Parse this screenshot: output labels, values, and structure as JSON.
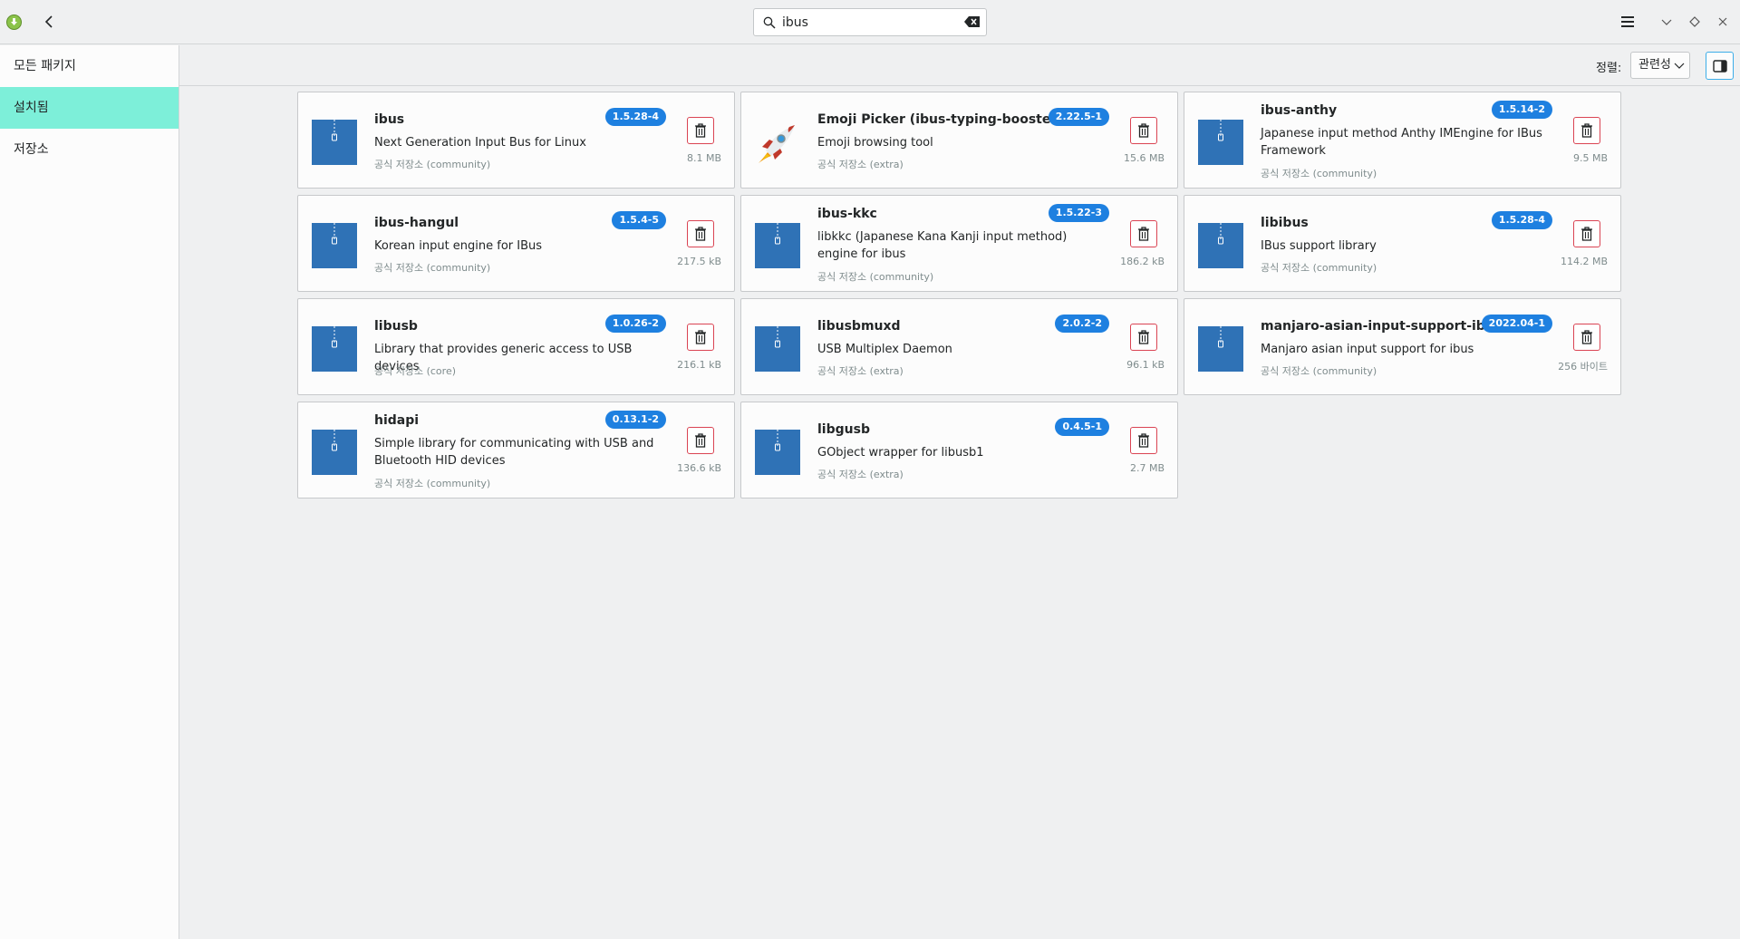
{
  "window": {
    "search_value": "ibus",
    "search_placeholder": "",
    "icons": {
      "logo": "pamac-logo-icon",
      "back": "chevron-left-icon",
      "search": "search-icon",
      "clear": "clear-text-icon",
      "menu": "hamburger-menu-icon",
      "minimize": "chevron-down-icon",
      "maximize": "diamond-icon",
      "close": "close-icon"
    }
  },
  "sidebar": {
    "items": [
      {
        "label": "모든 패키지",
        "active": false
      },
      {
        "label": "설치됨",
        "active": true
      },
      {
        "label": "저장소",
        "active": false
      }
    ]
  },
  "sortbar": {
    "label": "정렬:",
    "selected": "관련성"
  },
  "colors": {
    "accent": "#3daee9",
    "active_item": "#7defd9",
    "badge": "#1e80e0",
    "remove": "#da4453"
  },
  "packages": [
    {
      "name": "ibus",
      "version": "1.5.28-4",
      "desc": "Next Generation Input Bus for Linux",
      "repo": "공식 저장소 (community)",
      "size": "8.1 MB",
      "icon": "archive-icon"
    },
    {
      "name": "Emoji Picker (ibus-typing-booster)",
      "version": "2.22.5-1",
      "desc": "Emoji browsing tool",
      "repo": "공식 저장소 (extra)",
      "size": "15.6 MB",
      "icon": "rocket-icon"
    },
    {
      "name": "ibus-anthy",
      "version": "1.5.14-2",
      "desc": "Japanese input method Anthy IMEngine for IBus Framework",
      "repo": "공식 저장소 (community)",
      "size": "9.5 MB",
      "icon": "archive-icon"
    },
    {
      "name": "ibus-hangul",
      "version": "1.5.4-5",
      "desc": "Korean input engine for IBus",
      "repo": "공식 저장소 (community)",
      "size": "217.5 kB",
      "icon": "archive-icon"
    },
    {
      "name": "ibus-kkc",
      "version": "1.5.22-3",
      "desc": "libkkc (Japanese Kana Kanji input method) engine for ibus",
      "repo": "공식 저장소 (community)",
      "size": "186.2 kB",
      "icon": "archive-icon"
    },
    {
      "name": "libibus",
      "version": "1.5.28-4",
      "desc": "IBus support library",
      "repo": "공식 저장소 (community)",
      "size": "114.2 MB",
      "icon": "archive-icon"
    },
    {
      "name": "libusb",
      "version": "1.0.26-2",
      "desc": "Library that provides generic access to USB devices",
      "repo": "공식 저장소 (core)",
      "size": "216.1 kB",
      "icon": "archive-icon"
    },
    {
      "name": "libusbmuxd",
      "version": "2.0.2-2",
      "desc": "USB Multiplex Daemon",
      "repo": "공식 저장소 (extra)",
      "size": "96.1 kB",
      "icon": "archive-icon"
    },
    {
      "name": "manjaro-asian-input-support-ibus",
      "version": "2022.04-1",
      "desc": "Manjaro asian input support for ibus",
      "repo": "공식 저장소 (community)",
      "size": "256 바이트",
      "icon": "archive-icon"
    },
    {
      "name": "hidapi",
      "version": "0.13.1-2",
      "desc": "Simple library for communicating with USB and Bluetooth HID devices",
      "repo": "공식 저장소 (community)",
      "size": "136.6 kB",
      "icon": "archive-icon"
    },
    {
      "name": "libgusb",
      "version": "0.4.5-1",
      "desc": "GObject wrapper for libusb1",
      "repo": "공식 저장소 (extra)",
      "size": "2.7 MB",
      "icon": "archive-icon"
    }
  ]
}
